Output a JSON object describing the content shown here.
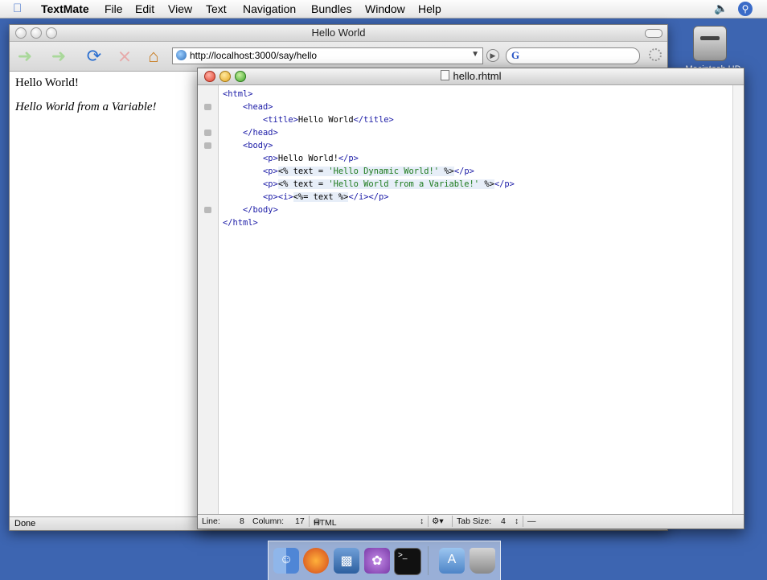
{
  "menubar": {
    "apple": "",
    "items": [
      "TextMate",
      "File",
      "Edit",
      "View",
      "Text",
      "Navigation",
      "Bundles",
      "Window",
      "Help"
    ],
    "volume_icon": "speaker-icon",
    "spotlight_icon": "spotlight-icon"
  },
  "desktop": {
    "drive_label": "Macintosh HD"
  },
  "browser": {
    "title": "Hello World",
    "url": "http://localhost:3000/say/hello",
    "search_placeholder": "",
    "search_engine_glyph": "G",
    "page_heading": "Hello World!",
    "page_italic": "Hello World from a Variable!",
    "status": "Done",
    "buttons": [
      "back-icon",
      "forward-icon",
      "reload-icon",
      "stop-icon",
      "home-icon"
    ]
  },
  "editor": {
    "title": "hello.rhtml",
    "code_lines": [
      "<html>",
      "    <head>",
      "        <title>Hello World</title>",
      "    </head>",
      "    <body>",
      "        <p>Hello World!</p>",
      "        <p><% text = 'Hello Dynamic World!' %></p>",
      "        <p><% text = 'Hello World from a Variable!' %></p>",
      "        <p><i><%= text %></i></p>",
      "    </body>",
      "</html>"
    ],
    "status": {
      "line_label": "Line:",
      "line_value": "8",
      "column_label": "Column:",
      "column_value": "17",
      "language": "HTML",
      "tab_size_label": "Tab Size:",
      "tab_size_value": "4",
      "symbol": "—"
    }
  },
  "dock": {
    "items": [
      "finder-icon",
      "firefox-icon",
      "preview-icon",
      "textmate-icon",
      "terminal-icon",
      "applications-icon",
      "trash-icon"
    ]
  },
  "colors": {
    "desktop": "#3d65b1",
    "tag": "#1a1aa6",
    "string": "#1c7a1c",
    "embedded_bg": "#e7eef8"
  }
}
